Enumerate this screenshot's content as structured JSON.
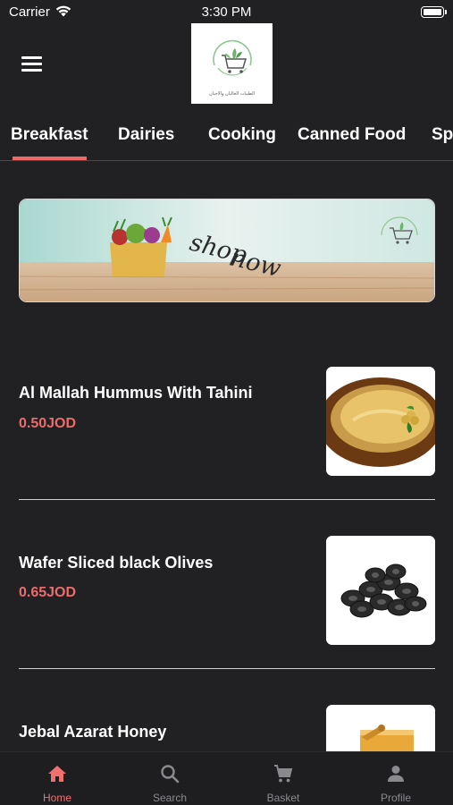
{
  "status_bar": {
    "carrier": "Carrier",
    "time": "3:30 PM"
  },
  "header": {
    "logo_text": "الطيبات الغالبان والأجبان",
    "menu_icon": "hamburger-menu-icon"
  },
  "tabs": [
    {
      "label": "Breakfast",
      "active": true
    },
    {
      "label": "Dairies",
      "active": false
    },
    {
      "label": "Cooking",
      "active": false
    },
    {
      "label": "Canned Food",
      "active": false
    },
    {
      "label": "Sp",
      "active": false
    }
  ],
  "banner": {
    "text_line1": "shop",
    "text_line2": "now"
  },
  "products": [
    {
      "name": "Al Mallah Hummus With Tahini",
      "price": "0.50JOD",
      "image": "hummus-plate"
    },
    {
      "name": "Wafer Sliced black Olives",
      "price": "0.65JOD",
      "image": "black-olives"
    },
    {
      "name": "Jebal Azarat Honey",
      "price": "",
      "image": "honey-jar"
    }
  ],
  "bottom_nav": [
    {
      "label": "Home",
      "icon": "home-icon",
      "active": true
    },
    {
      "label": "Search",
      "icon": "search-icon",
      "active": false
    },
    {
      "label": "Basket",
      "icon": "cart-icon",
      "active": false
    },
    {
      "label": "Profile",
      "icon": "person-icon",
      "active": false
    }
  ],
  "colors": {
    "background": "#212124",
    "accent": "#f06868",
    "inactive_nav": "#8a8a8e"
  }
}
